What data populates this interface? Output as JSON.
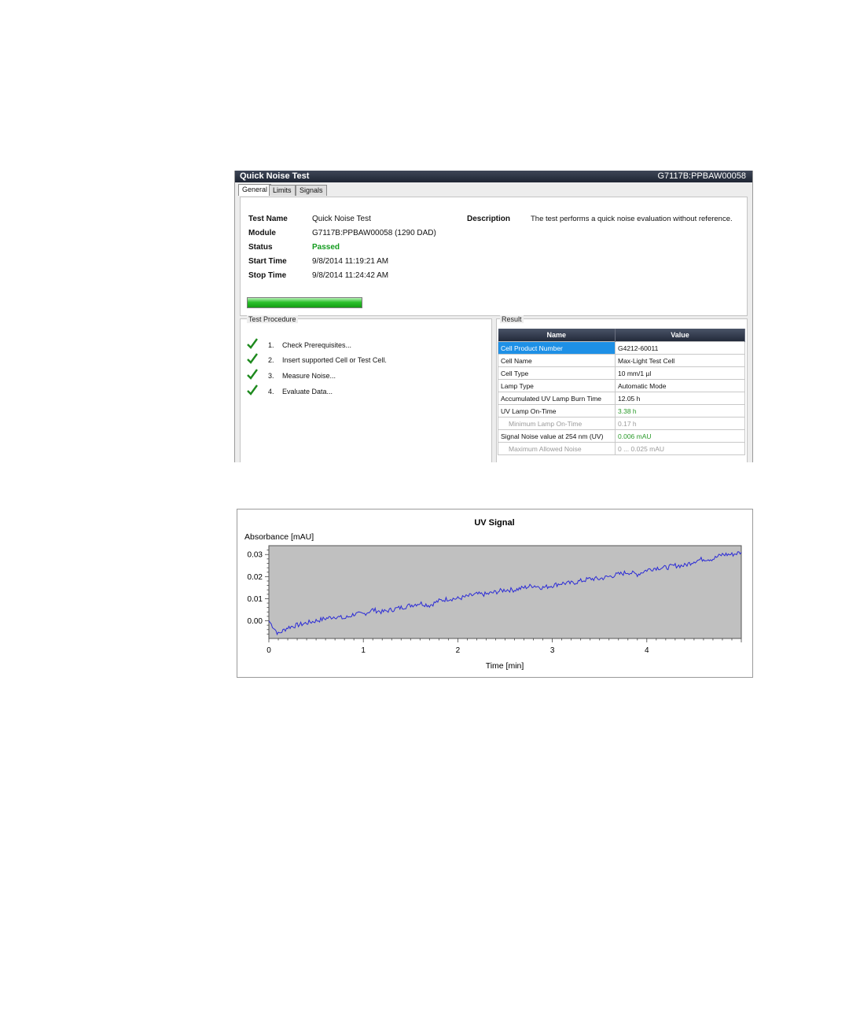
{
  "window": {
    "title": "Quick Noise Test",
    "module_id": "G7117B:PPBAW00058"
  },
  "tabs": [
    {
      "label": "General",
      "active": true
    },
    {
      "label": "Limits",
      "active": false
    },
    {
      "label": "Signals",
      "active": false
    }
  ],
  "general": {
    "test_name_label": "Test Name",
    "test_name": "Quick Noise Test",
    "module_label": "Module",
    "module": "G7117B:PPBAW00058 (1290 DAD)",
    "status_label": "Status",
    "status": "Passed",
    "start_time_label": "Start Time",
    "start_time": "9/8/2014 11:19:21 AM",
    "stop_time_label": "Stop Time",
    "stop_time": "9/8/2014 11:24:42 AM",
    "description_label": "Description",
    "description": "The test performs a quick noise evaluation without reference.",
    "progress_fraction": 1.0,
    "progress_color": "#2cc12c"
  },
  "procedure": {
    "title": "Test Procedure",
    "steps": [
      {
        "num": "1.",
        "label": "Check Prerequisites...",
        "icon": "check-icon"
      },
      {
        "num": "2.",
        "label": "Insert supported Cell or Test Cell.",
        "icon": "check-icon"
      },
      {
        "num": "3.",
        "label": "Measure Noise...",
        "icon": "check-icon"
      },
      {
        "num": "4.",
        "label": "Evaluate Data...",
        "icon": "check-icon"
      }
    ]
  },
  "result": {
    "title": "Result",
    "headers": {
      "name": "Name",
      "value": "Value"
    },
    "rows": [
      {
        "name": "Cell Product Number",
        "value": "G4212-60011"
      },
      {
        "name": "Cell Name",
        "value": "Max-Light Test Cell"
      },
      {
        "name": "Cell Type",
        "value": "10 mm/1 µl"
      },
      {
        "name": "Lamp Type",
        "value": "Automatic Mode"
      },
      {
        "name": "Accumulated UV Lamp Burn Time",
        "value": "12.05 h"
      },
      {
        "name": "UV Lamp On-Time",
        "value": "3.38 h"
      },
      {
        "name": "Minimum Lamp On-Time",
        "value": "0.17 h"
      },
      {
        "name": "Signal Noise value at 254 nm (UV)",
        "value": "0.006 mAU"
      },
      {
        "name": "Maximum Allowed Noise",
        "value": "0 ... 0.025 mAU"
      }
    ]
  },
  "chart_data": {
    "type": "line",
    "title": "UV Signal",
    "ylabel": "Absorbance [mAU]",
    "xlabel": "Time [min]",
    "xlim": [
      0,
      5
    ],
    "ylim": [
      -0.008,
      0.034
    ],
    "xticks": [
      "0",
      "1",
      "2",
      "3",
      "4"
    ],
    "yticks": [
      "0.00",
      "0.01",
      "0.02",
      "0.03"
    ],
    "plot_background": "#c0c0c0",
    "line_color": "#2b2bd6",
    "series": [
      {
        "x": [
          0,
          0.1,
          0.2,
          0.3,
          0.4,
          0.5,
          0.6,
          0.7,
          0.8,
          0.9,
          1.0,
          1.1,
          1.2,
          1.3,
          1.4,
          1.5,
          1.6,
          1.7,
          1.8,
          1.9,
          2.0,
          2.1,
          2.2,
          2.3,
          2.4,
          2.5,
          2.6,
          2.7,
          2.8,
          2.9,
          3.0,
          3.1,
          3.2,
          3.3,
          3.4,
          3.5,
          3.6,
          3.7,
          3.8,
          3.9,
          4.0,
          4.1,
          4.2,
          4.3,
          4.4,
          4.5,
          4.6,
          4.7,
          4.8,
          4.9,
          5.0
        ],
        "values": [
          0.0,
          -0.006,
          -0.003,
          -0.002,
          -0.001,
          0.0,
          0.001,
          0.002,
          0.001,
          0.003,
          0.003,
          0.005,
          0.004,
          0.005,
          0.006,
          0.007,
          0.008,
          0.007,
          0.009,
          0.01,
          0.01,
          0.011,
          0.012,
          0.012,
          0.013,
          0.014,
          0.014,
          0.015,
          0.016,
          0.015,
          0.016,
          0.017,
          0.017,
          0.018,
          0.019,
          0.019,
          0.02,
          0.021,
          0.022,
          0.021,
          0.023,
          0.024,
          0.024,
          0.025,
          0.025,
          0.027,
          0.028,
          0.028,
          0.03,
          0.03,
          0.031
        ]
      }
    ]
  }
}
